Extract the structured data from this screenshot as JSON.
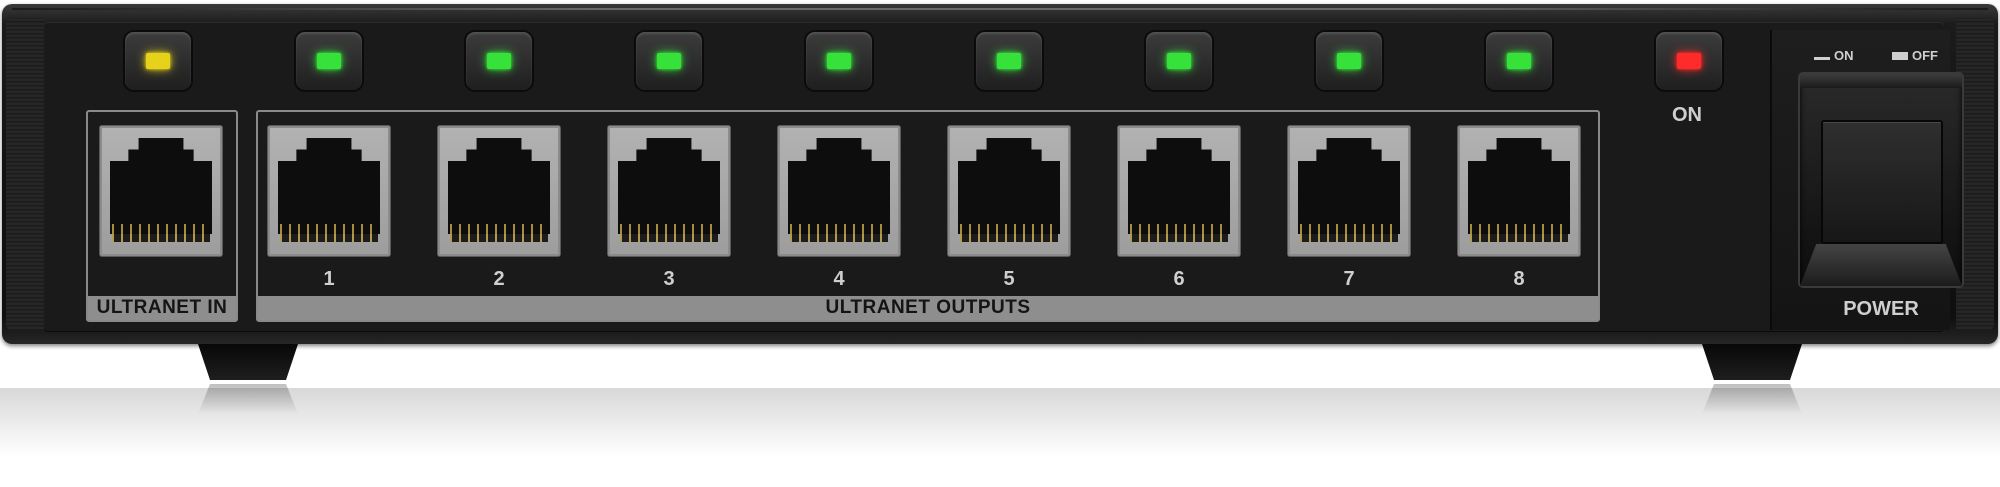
{
  "device": {
    "leds": [
      {
        "id": "in",
        "color": "#e6d21a"
      },
      {
        "id": "1",
        "color": "#36e23a"
      },
      {
        "id": "2",
        "color": "#36e23a"
      },
      {
        "id": "3",
        "color": "#36e23a"
      },
      {
        "id": "4",
        "color": "#36e23a"
      },
      {
        "id": "5",
        "color": "#36e23a"
      },
      {
        "id": "6",
        "color": "#36e23a"
      },
      {
        "id": "7",
        "color": "#36e23a"
      },
      {
        "id": "8",
        "color": "#36e23a"
      },
      {
        "id": "power",
        "color": "#ff2a2a"
      }
    ],
    "power_led_label": "ON",
    "input": {
      "label": "ULTRANET IN"
    },
    "outputs": {
      "label": "ULTRANET OUTPUTS",
      "ports": [
        "1",
        "2",
        "3",
        "4",
        "5",
        "6",
        "7",
        "8"
      ]
    },
    "power_switch": {
      "legend_on": "ON",
      "legend_off": "OFF",
      "label": "POWER"
    }
  }
}
